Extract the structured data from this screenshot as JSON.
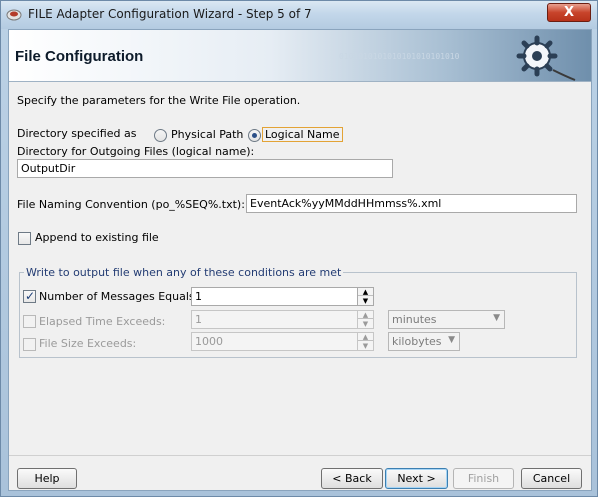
{
  "window": {
    "title": "FILE Adapter Configuration Wizard - Step 5 of 7",
    "close_label": "X"
  },
  "header": {
    "title": "File Configuration",
    "binary": "0101010101010101010101010"
  },
  "form": {
    "instructions": "Specify the parameters for the Write File operation.",
    "directory_label": "Directory specified as",
    "radio_physical": "Physical Path",
    "radio_logical": "Logical Name",
    "selected_mode": "Logical Name",
    "outgoing_dir_label": "Directory for Outgoing Files (logical name):",
    "outgoing_dir_value": "OutputDir",
    "naming_label": "File Naming Convention (po_%SEQ%.txt):",
    "naming_value": "EventAck%yyMMddHHmmss%.xml",
    "append_label": "Append to existing file",
    "append_checked": false
  },
  "conditions": {
    "group_title": "Write to output file when any of these conditions are met",
    "num_messages_label": "Number of Messages Equals:",
    "num_messages_checked": true,
    "num_messages_value": "1",
    "elapsed_label": "Elapsed Time Exceeds:",
    "elapsed_checked": false,
    "elapsed_value": "1",
    "elapsed_unit": "minutes",
    "size_label": "File Size Exceeds:",
    "size_checked": false,
    "size_value": "1000",
    "size_unit": "kilobytes"
  },
  "buttons": {
    "help": "Help",
    "back": "< Back",
    "next": "Next >",
    "finish": "Finish",
    "cancel": "Cancel"
  },
  "icons": {
    "app": "oracle-adapter-icon",
    "header": "gear-icon",
    "spin_up": "spin-up-icon",
    "spin_down": "spin-down-icon",
    "dropdown": "chevron-down-icon"
  },
  "colors": {
    "title_bar": "#c3d7ea",
    "close_button": "#c8442b",
    "focus_outline": "#e3a335",
    "group_title": "#233c73"
  }
}
